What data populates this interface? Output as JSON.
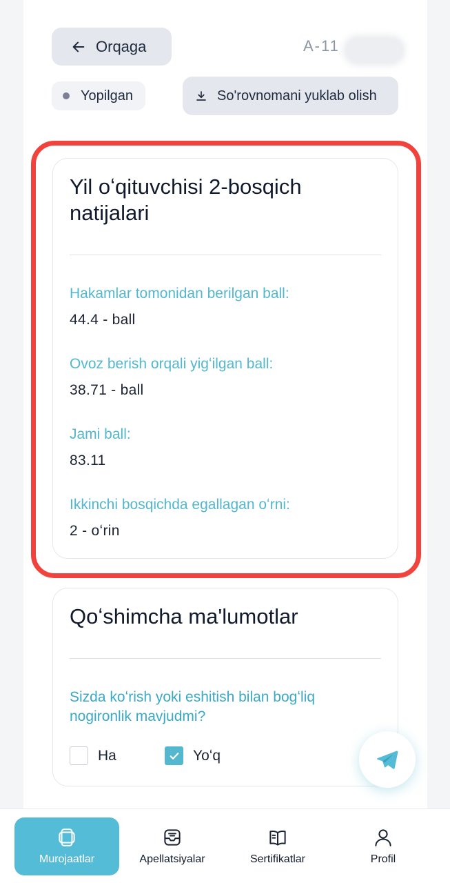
{
  "header": {
    "back_label": "Orqaga",
    "application_id": "A-11",
    "status_label": "Yopilgan",
    "download_label": "So'rovnomani yuklab olish"
  },
  "results_card": {
    "title": "Yil oʻqituvchisi 2-bosqich natijalari",
    "fields": [
      {
        "label": "Hakamlar tomonidan berilgan ball:",
        "value": "44.4 - ball"
      },
      {
        "label": "Ovoz berish orqali yigʻilgan ball:",
        "value": "38.71 - ball"
      },
      {
        "label": "Jami ball:",
        "value": "83.11"
      },
      {
        "label": "Ikkinchi bosqichda egallagan oʻrni:",
        "value": "2 - oʻrin"
      }
    ]
  },
  "extra_card": {
    "title": "Qoʻshimcha ma'lumotlar",
    "question": "Sizda koʻrish yoki eshitish bilan bogʻliq nogironlik mavjudmi?",
    "options": [
      {
        "label": "Ha",
        "checked": false
      },
      {
        "label": "Yoʻq",
        "checked": true
      }
    ]
  },
  "fab": {
    "icon": "telegram-send-icon"
  },
  "bottom_nav": [
    {
      "label": "Murojaatlar",
      "icon": "applications-icon",
      "active": true
    },
    {
      "label": "Apellatsiyalar",
      "icon": "appeal-inbox-icon",
      "active": false
    },
    {
      "label": "Sertifikatlar",
      "icon": "certificate-book-icon",
      "active": false
    },
    {
      "label": "Profil",
      "icon": "profile-icon",
      "active": false
    }
  ],
  "colors": {
    "accent": "#55bcd8",
    "label_text": "#52b7cf",
    "highlight_border": "#f0433d",
    "button_bg": "#e4e8ee"
  }
}
